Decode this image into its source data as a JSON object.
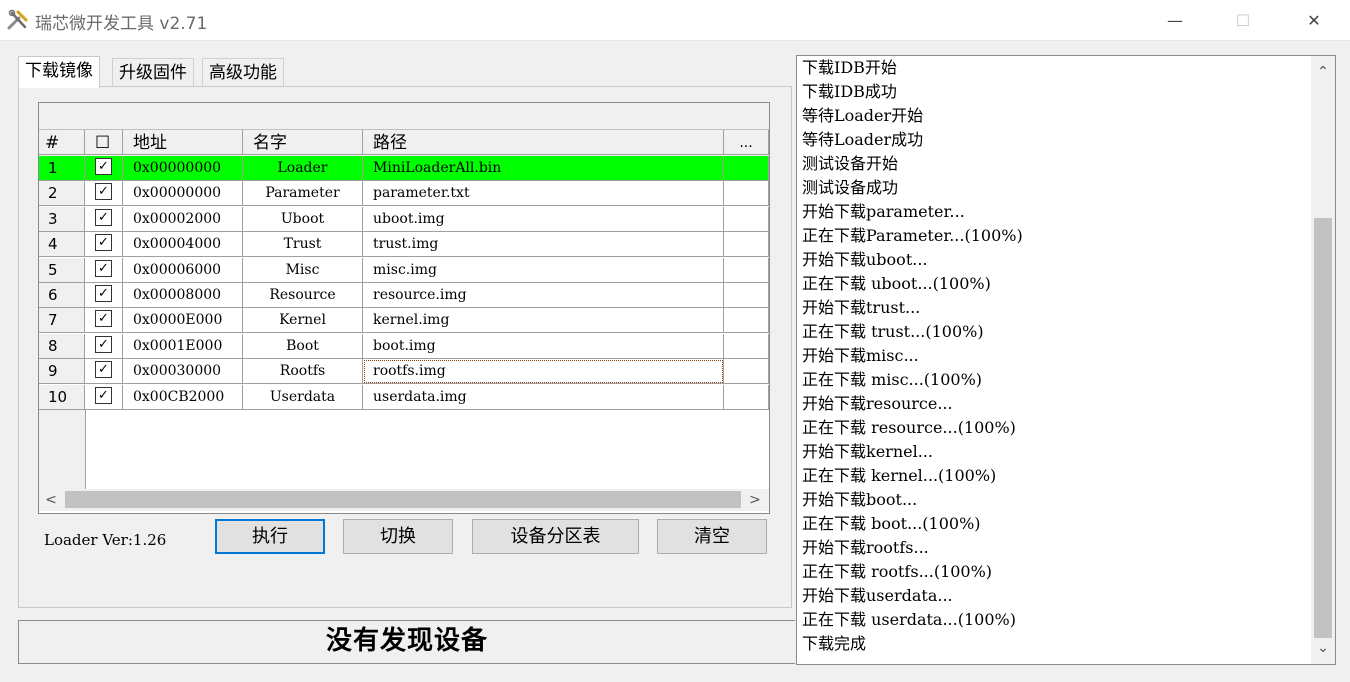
{
  "window": {
    "title": "瑞芯微开发工具 v2.71",
    "minimize": "—",
    "maximize": "☐",
    "close": "✕"
  },
  "tabs": [
    {
      "label": "下载镜像",
      "active": true
    },
    {
      "label": "升级固件",
      "active": false
    },
    {
      "label": "高级功能",
      "active": false
    }
  ],
  "grid": {
    "headers": {
      "num": "#",
      "check": "☐",
      "address": "地址",
      "name": "名字",
      "path": "路径",
      "more": "..."
    },
    "rows": [
      {
        "num": "1",
        "checked": "✓",
        "address": "0x00000000",
        "name": "Loader",
        "path": "MiniLoaderAll.bin",
        "selected": true
      },
      {
        "num": "2",
        "checked": "✓",
        "address": "0x00000000",
        "name": "Parameter",
        "path": "parameter.txt"
      },
      {
        "num": "3",
        "checked": "✓",
        "address": "0x00002000",
        "name": "Uboot",
        "path": "uboot.img"
      },
      {
        "num": "4",
        "checked": "✓",
        "address": "0x00004000",
        "name": "Trust",
        "path": "trust.img"
      },
      {
        "num": "5",
        "checked": "✓",
        "address": "0x00006000",
        "name": "Misc",
        "path": "misc.img"
      },
      {
        "num": "6",
        "checked": "✓",
        "address": "0x00008000",
        "name": "Resource",
        "path": "resource.img"
      },
      {
        "num": "7",
        "checked": "✓",
        "address": "0x0000E000",
        "name": "Kernel",
        "path": "kernel.img"
      },
      {
        "num": "8",
        "checked": "✓",
        "address": "0x0001E000",
        "name": "Boot",
        "path": "boot.img"
      },
      {
        "num": "9",
        "checked": "✓",
        "address": "0x00030000",
        "name": "Rootfs",
        "path": "rootfs.img"
      },
      {
        "num": "10",
        "checked": "✓",
        "address": "0x00CB2000",
        "name": "Userdata",
        "path": "userdata.img"
      }
    ],
    "scroll_left": "<",
    "scroll_right": ">"
  },
  "controls": {
    "loader_version": "Loader Ver:1.26",
    "execute": "执行",
    "switch": "切换",
    "partition_table": "设备分区表",
    "clear": "清空"
  },
  "status": "没有发现设备",
  "log": {
    "lines": [
      "下载IDB开始",
      "下载IDB成功",
      "等待Loader开始",
      "等待Loader成功",
      "测试设备开始",
      "测试设备成功",
      "开始下载parameter...",
      "正在下载Parameter...(100%)",
      "开始下载uboot...",
      "正在下载 uboot...(100%)",
      "开始下载trust...",
      "正在下载 trust...(100%)",
      "开始下载misc...",
      "正在下载 misc...(100%)",
      "开始下载resource...",
      "正在下载 resource...(100%)",
      "开始下载kernel...",
      "正在下载 kernel...(100%)",
      "开始下载boot...",
      "正在下载 boot...(100%)",
      "开始下载rootfs...",
      "正在下载 rootfs...(100%)",
      "开始下载userdata...",
      "正在下载 userdata...(100%)",
      "下载完成"
    ],
    "scroll_up": "⌃",
    "scroll_down": "⌄"
  },
  "colors": {
    "selected_row": "#00ff00",
    "primary_button_border": "#0078d7"
  }
}
